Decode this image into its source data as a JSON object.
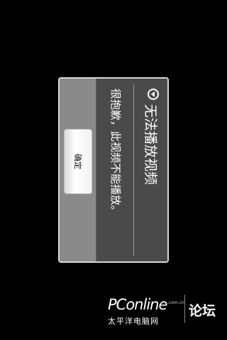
{
  "dialog": {
    "title": "无法播放视频",
    "message": "很抱歉，此视频不能播放。",
    "ok_label": "确定",
    "icon": "info-icon"
  },
  "watermark": {
    "logo": "PConline",
    "domain": ".com.cn",
    "subtitle": "太平洋电脑网",
    "forum": "论坛"
  }
}
